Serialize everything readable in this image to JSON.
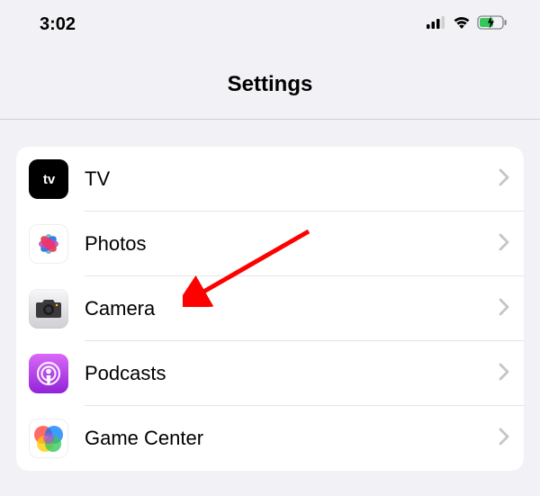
{
  "status_bar": {
    "time": "3:02"
  },
  "header": {
    "title": "Settings"
  },
  "list": {
    "items": [
      {
        "label": "TV"
      },
      {
        "label": "Photos"
      },
      {
        "label": "Camera"
      },
      {
        "label": "Podcasts"
      },
      {
        "label": "Game Center"
      }
    ]
  }
}
